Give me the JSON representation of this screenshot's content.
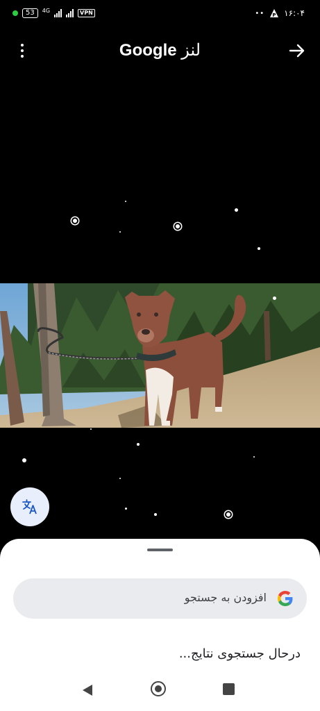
{
  "status_bar": {
    "battery": "53",
    "network": "4G",
    "vpn": "VPN",
    "time": "۱۶:۰۴"
  },
  "header": {
    "title_brand": "Google",
    "title_word": "لنز"
  },
  "icons": {
    "more": "more-vert-icon",
    "forward": "arrow-forward-icon",
    "translate": "translate-icon",
    "google": "google-g-icon"
  },
  "sheet": {
    "search_placeholder": "افزودن به جستجو",
    "status": "درحال جستجوی نتایج..."
  },
  "colors": {
    "background": "#000000",
    "sheet": "#ffffff",
    "search_box": "#e9ebee",
    "translate_button": "#e8eefb",
    "translate_icon": "#1a56c8"
  }
}
